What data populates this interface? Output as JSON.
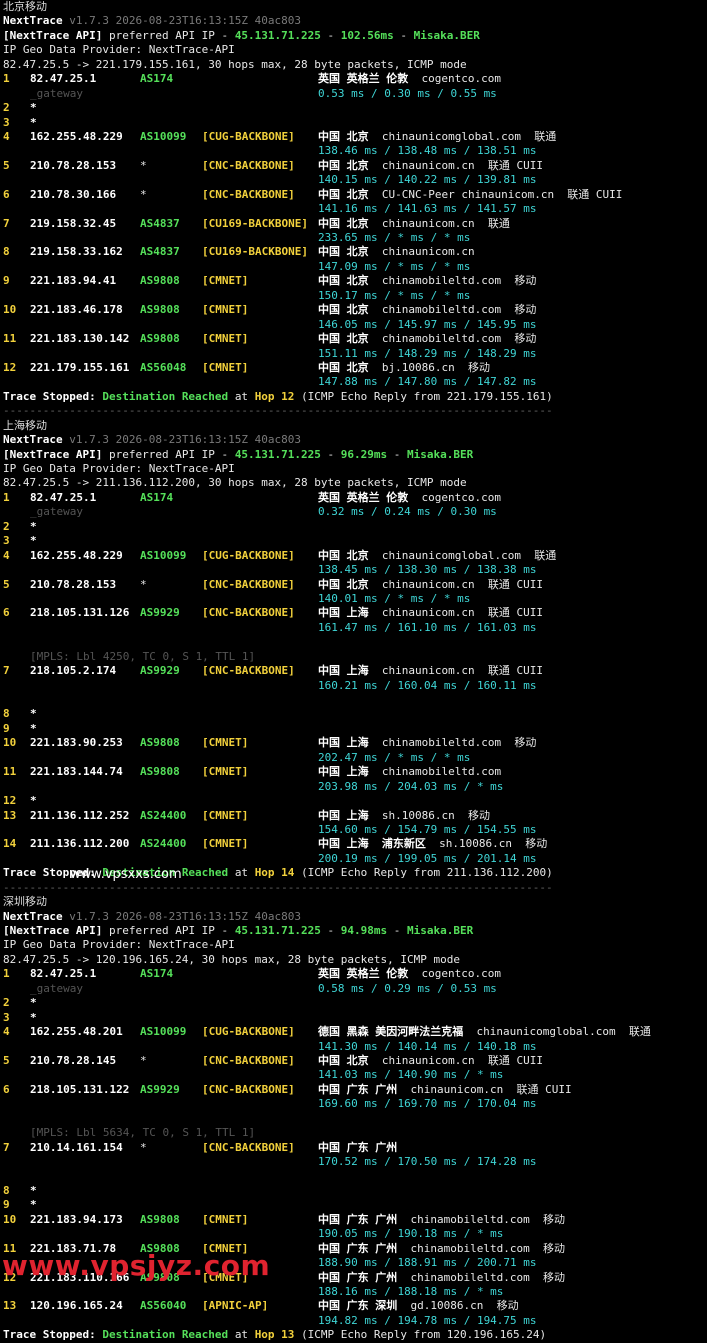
{
  "sections": [
    {
      "title": "北京移动",
      "nt_name": "NextTrace",
      "nt_ver": "v1.7.3 2026-08-23T16:13:15Z 40ac803",
      "api_label": "[NextTrace API]",
      "api_pref": "preferred API IP -",
      "api_ip": "45.131.71.225",
      "api_dash": "-",
      "api_ms": "102.56ms",
      "api_dash2": "-",
      "api_host": "Misaka.BER",
      "geo_provider": "IP Geo Data Provider: NextTrace-API",
      "route": "82.47.25.5 -> 221.179.155.161, 30 hops max, 28 byte packets, ICMP mode",
      "hops": [
        {
          "n": "1",
          "ip": "82.47.25.1",
          "as": "AS174",
          "tag": "",
          "geo": "英国 英格兰 伦敦",
          "host": "cogentco.com",
          "gateway": "_gateway",
          "lat": "0.53 ms / 0.30 ms / 0.55 ms"
        },
        {
          "n": "2",
          "ip": "*"
        },
        {
          "n": "3",
          "ip": "*"
        },
        {
          "n": "4",
          "ip": "162.255.48.229",
          "as": "AS10099",
          "tag": "[CUG-BACKBONE]",
          "geo": "中国 北京",
          "host": "chinaunicomglobal.com  联通",
          "lat": "138.46 ms / 138.48 ms / 138.51 ms"
        },
        {
          "n": "5",
          "ip": "210.78.28.153",
          "as": "*",
          "tag": "[CNC-BACKBONE]",
          "geo": "中国 北京",
          "host": "chinaunicom.cn  联通 CUII",
          "lat": "140.15 ms / 140.22 ms / 139.81 ms"
        },
        {
          "n": "6",
          "ip": "210.78.30.166",
          "as": "*",
          "tag": "[CNC-BACKBONE]",
          "geo": "中国 北京",
          "host": "CU-CNC-Peer chinaunicom.cn  联通 CUII",
          "lat": "141.16 ms / 141.63 ms / 141.57 ms"
        },
        {
          "n": "7",
          "ip": "219.158.32.45",
          "as": "AS4837",
          "tag": "[CU169-BACKBONE]",
          "geo": "中国 北京",
          "host": "chinaunicom.cn  联通",
          "lat": "233.65 ms / * ms / * ms"
        },
        {
          "n": "8",
          "ip": "219.158.33.162",
          "as": "AS4837",
          "tag": "[CU169-BACKBONE]",
          "geo": "中国 北京",
          "host": "chinaunicom.cn",
          "lat": "147.09 ms / * ms / * ms"
        },
        {
          "n": "9",
          "ip": "221.183.94.41",
          "as": "AS9808",
          "tag": "[CMNET]",
          "geo": "中国 北京",
          "host": "chinamobileltd.com  移动",
          "lat": "150.17 ms / * ms / * ms"
        },
        {
          "n": "10",
          "ip": "221.183.46.178",
          "as": "AS9808",
          "tag": "[CMNET]",
          "geo": "中国 北京",
          "host": "chinamobileltd.com  移动",
          "lat": "146.05 ms / 145.97 ms / 145.95 ms"
        },
        {
          "n": "11",
          "ip": "221.183.130.142",
          "as": "AS9808",
          "tag": "[CMNET]",
          "geo": "中国 北京",
          "host": "chinamobileltd.com  移动",
          "lat": "151.11 ms / 148.29 ms / 148.29 ms"
        },
        {
          "n": "12",
          "ip": "221.179.155.161",
          "as": "AS56048",
          "tag": "[CMNET]",
          "geo": "中国 北京",
          "host": "bj.10086.cn  移动",
          "lat": "147.88 ms / 147.80 ms / 147.82 ms"
        }
      ],
      "stop_label": "Trace Stopped:",
      "stop_dest": "Destination Reached",
      "stop_at": "at",
      "stop_hop": "Hop 12",
      "stop_tail": "(ICMP Echo Reply from 221.179.155.161)",
      "separator": "-----------------------------------------------------------------------------------"
    },
    {
      "title": "上海移动",
      "nt_name": "NextTrace",
      "nt_ver": "v1.7.3 2026-08-23T16:13:15Z 40ac803",
      "api_label": "[NextTrace API]",
      "api_pref": "preferred API IP -",
      "api_ip": "45.131.71.225",
      "api_dash": "-",
      "api_ms": "96.29ms",
      "api_dash2": "-",
      "api_host": "Misaka.BER",
      "geo_provider": "IP Geo Data Provider: NextTrace-API",
      "route": "82.47.25.5 -> 211.136.112.200, 30 hops max, 28 byte packets, ICMP mode",
      "hops": [
        {
          "n": "1",
          "ip": "82.47.25.1",
          "as": "AS174",
          "tag": "",
          "geo": "英国 英格兰 伦敦",
          "host": "cogentco.com",
          "gateway": "_gateway",
          "lat": "0.32 ms / 0.24 ms / 0.30 ms"
        },
        {
          "n": "2",
          "ip": "*"
        },
        {
          "n": "3",
          "ip": "*"
        },
        {
          "n": "4",
          "ip": "162.255.48.229",
          "as": "AS10099",
          "tag": "[CUG-BACKBONE]",
          "geo": "中国 北京",
          "host": "chinaunicomglobal.com  联通",
          "lat": "138.45 ms / 138.30 ms / 138.38 ms"
        },
        {
          "n": "5",
          "ip": "210.78.28.153",
          "as": "*",
          "tag": "[CNC-BACKBONE]",
          "geo": "中国 北京",
          "host": "chinaunicom.cn  联通 CUII",
          "lat": "140.01 ms / * ms / * ms"
        },
        {
          "n": "6",
          "ip": "218.105.131.126",
          "as": "AS9929",
          "tag": "[CNC-BACKBONE]",
          "geo": "中国 上海",
          "host": "chinaunicom.cn  联通 CUII",
          "lat": "161.47 ms / 161.10 ms / 161.03 ms",
          "mpls": "[MPLS: Lbl 4250, TC 0, S 1, TTL 1]"
        },
        {
          "n": "7",
          "ip": "218.105.2.174",
          "as": "AS9929",
          "tag": "[CNC-BACKBONE]",
          "geo": "中国 上海",
          "host": "chinaunicom.cn  联通 CUII",
          "lat": "160.21 ms / 160.04 ms / 160.11 ms",
          "gap": true
        },
        {
          "n": "8",
          "ip": "*"
        },
        {
          "n": "9",
          "ip": "*"
        },
        {
          "n": "10",
          "ip": "221.183.90.253",
          "as": "AS9808",
          "tag": "[CMNET]",
          "geo": "中国 上海",
          "host": "chinamobileltd.com  移动",
          "lat": "202.47 ms / * ms / * ms"
        },
        {
          "n": "11",
          "ip": "221.183.144.74",
          "as": "AS9808",
          "tag": "[CMNET]",
          "geo": "中国 上海",
          "host": "chinamobileltd.com",
          "lat": "203.98 ms / 204.03 ms / * ms"
        },
        {
          "n": "12",
          "ip": "*"
        },
        {
          "n": "13",
          "ip": "211.136.112.252",
          "as": "AS24400",
          "tag": "[CMNET]",
          "geo": "中国 上海",
          "host": "sh.10086.cn  移动",
          "lat": "154.60 ms / 154.79 ms / 154.55 ms"
        },
        {
          "n": "14",
          "ip": "211.136.112.200",
          "as": "AS24400",
          "tag": "[CMNET]",
          "geo": "中国 上海  浦东新区",
          "host": "sh.10086.cn  移动",
          "lat": "200.19 ms / 199.05 ms / 201.14 ms"
        }
      ],
      "stop_label": "Trace Stopped:",
      "stop_dest": "Destination Reached",
      "stop_at": "at",
      "stop_hop": "Hop 14",
      "stop_tail": "(ICMP Echo Reply from 211.136.112.200)",
      "separator": "-----------------------------------------------------------------------------------"
    },
    {
      "title": "深圳移动",
      "nt_name": "NextTrace",
      "nt_ver": "v1.7.3 2026-08-23T16:13:15Z 40ac803",
      "api_label": "[NextTrace API]",
      "api_pref": "preferred API IP -",
      "api_ip": "45.131.71.225",
      "api_dash": "-",
      "api_ms": "94.98ms",
      "api_dash2": "-",
      "api_host": "Misaka.BER",
      "geo_provider": "IP Geo Data Provider: NextTrace-API",
      "route": "82.47.25.5 -> 120.196.165.24, 30 hops max, 28 byte packets, ICMP mode",
      "hops": [
        {
          "n": "1",
          "ip": "82.47.25.1",
          "as": "AS174",
          "tag": "",
          "geo": "英国 英格兰 伦敦",
          "host": "cogentco.com",
          "gateway": "_gateway",
          "lat": "0.58 ms / 0.29 ms / 0.53 ms"
        },
        {
          "n": "2",
          "ip": "*"
        },
        {
          "n": "3",
          "ip": "*"
        },
        {
          "n": "4",
          "ip": "162.255.48.201",
          "as": "AS10099",
          "tag": "[CUG-BACKBONE]",
          "geo": "德国 黑森 美因河畔法兰克福",
          "host": "chinaunicomglobal.com  联通",
          "lat": "141.30 ms / 140.14 ms / 140.18 ms"
        },
        {
          "n": "5",
          "ip": "210.78.28.145",
          "as": "*",
          "tag": "[CNC-BACKBONE]",
          "geo": "中国 北京",
          "host": "chinaunicom.cn  联通 CUII",
          "lat": "141.03 ms / 140.90 ms / * ms"
        },
        {
          "n": "6",
          "ip": "218.105.131.122",
          "as": "AS9929",
          "tag": "[CNC-BACKBONE]",
          "geo": "中国 广东 广州",
          "host": "chinaunicom.cn  联通 CUII",
          "lat": "169.60 ms / 169.70 ms / 170.04 ms",
          "mpls": "[MPLS: Lbl 5634, TC 0, S 1, TTL 1]"
        },
        {
          "n": "7",
          "ip": "210.14.161.154",
          "as": "*",
          "tag": "[CNC-BACKBONE]",
          "geo": "中国 广东 广州",
          "host": "",
          "lat": "170.52 ms / 170.50 ms / 174.28 ms",
          "gap": true
        },
        {
          "n": "8",
          "ip": "*"
        },
        {
          "n": "9",
          "ip": "*"
        },
        {
          "n": "10",
          "ip": "221.183.94.173",
          "as": "AS9808",
          "tag": "[CMNET]",
          "geo": "中国 广东 广州",
          "host": "chinamobileltd.com  移动",
          "lat": "190.05 ms / 190.18 ms / * ms"
        },
        {
          "n": "11",
          "ip": "221.183.71.78",
          "as": "AS9808",
          "tag": "[CMNET]",
          "geo": "中国 广东 广州",
          "host": "chinamobileltd.com  移动",
          "lat": "188.90 ms / 188.91 ms / 200.71 ms"
        },
        {
          "n": "12",
          "ip": "221.183.110.166",
          "as": "AS9808",
          "tag": "[CMNET]",
          "geo": "中国 广东 广州",
          "host": "chinamobileltd.com  移动",
          "lat": "188.16 ms / 188.18 ms / * ms"
        },
        {
          "n": "13",
          "ip": "120.196.165.24",
          "as": "AS56040",
          "tag": "[APNIC-AP]",
          "geo": "中国 广东 深圳",
          "host": "gd.10086.cn  移动",
          "lat": "194.82 ms / 194.78 ms / 194.75 ms"
        }
      ],
      "stop_label": "Trace Stopped:",
      "stop_dest": "Destination Reached",
      "stop_at": "at",
      "stop_hop": "Hop 13",
      "stop_tail": "(ICMP Echo Reply from 120.196.165.24)",
      "separator": ""
    }
  ],
  "watermarks": {
    "top": "www.vpsxxs.com",
    "bottom": "www.vpsjyz.com"
  },
  "colors": {
    "background": "#000000",
    "green": "#55e05a",
    "cyan": "#3fd6d6",
    "yellow": "#f2d13c",
    "gray": "#7a7a7a",
    "watermark_red": "#e0232f"
  }
}
